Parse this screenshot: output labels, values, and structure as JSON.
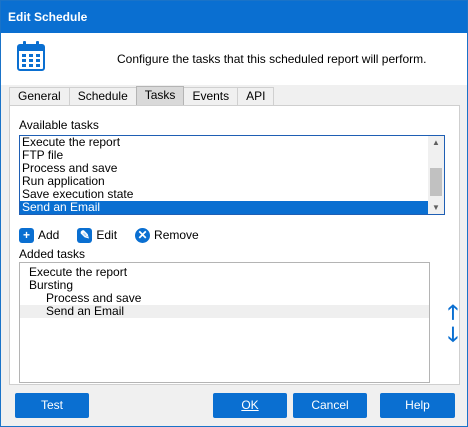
{
  "window": {
    "title": "Edit Schedule"
  },
  "header": {
    "description": "Configure the tasks that this scheduled report will perform.",
    "icon": "calendar-icon"
  },
  "tabs": [
    {
      "label": "General",
      "active": false
    },
    {
      "label": "Schedule",
      "active": false
    },
    {
      "label": "Tasks",
      "active": true
    },
    {
      "label": "Events",
      "active": false
    },
    {
      "label": "API",
      "active": false
    }
  ],
  "available": {
    "label": "Available tasks",
    "items": [
      "Execute the report",
      "FTP file",
      "Process and save",
      "Run application",
      "Save execution state",
      "Send an Email"
    ],
    "selected_index": 5
  },
  "actions": {
    "add": "Add",
    "edit": "Edit",
    "remove": "Remove"
  },
  "added": {
    "label": "Added tasks",
    "items": [
      {
        "text": "Execute the report",
        "level": 0
      },
      {
        "text": "Bursting",
        "level": 0
      },
      {
        "text": "Process and save",
        "level": 1
      },
      {
        "text": "Send an Email",
        "level": 1
      }
    ],
    "highlighted_index": 3
  },
  "buttons": {
    "test": "Test",
    "ok": "OK",
    "cancel": "Cancel",
    "help": "Help"
  },
  "colors": {
    "accent": "#0a6fd1"
  }
}
